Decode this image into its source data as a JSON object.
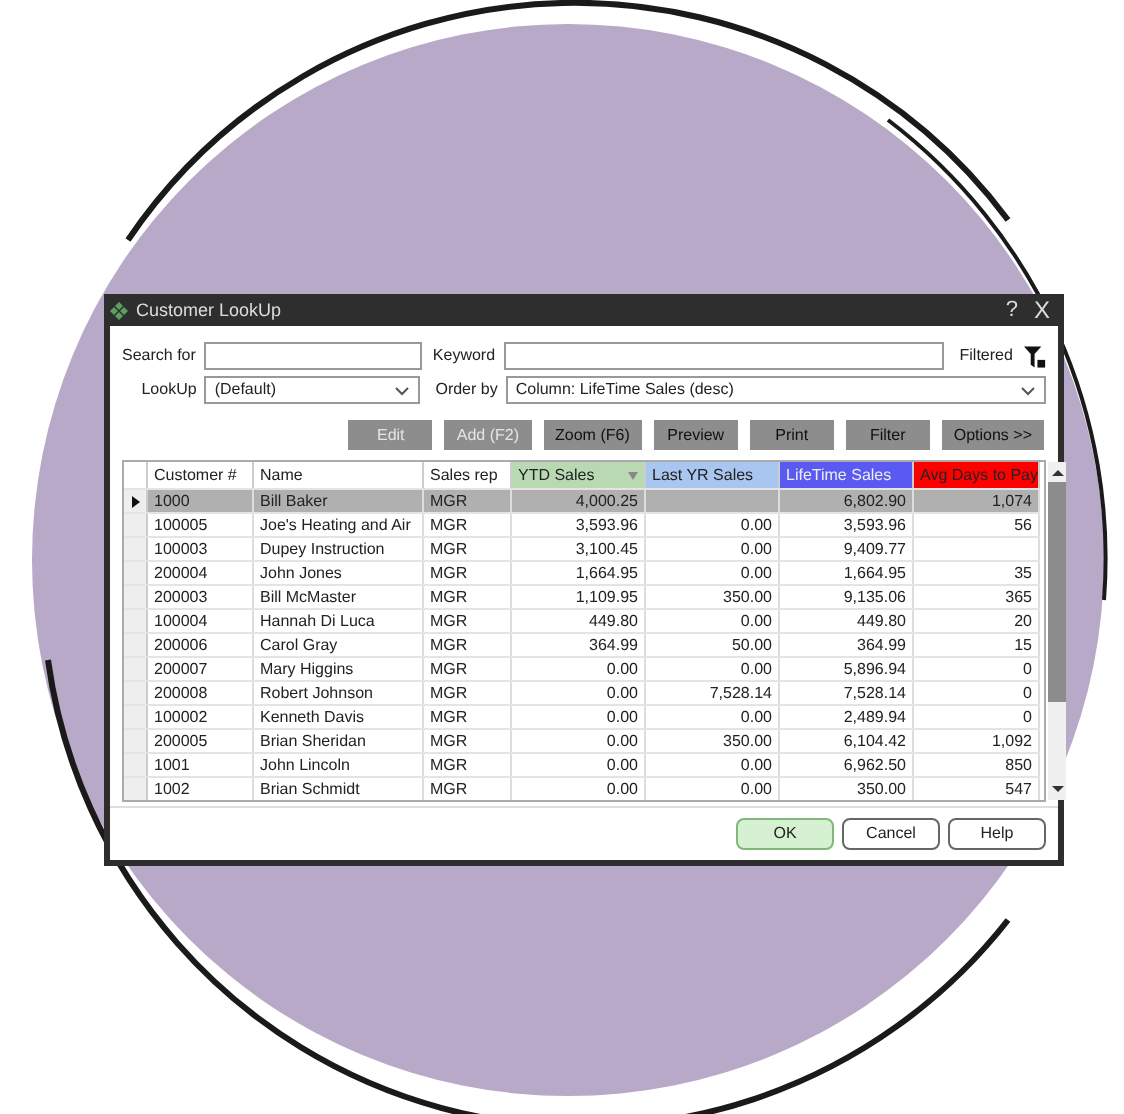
{
  "window": {
    "title": "Customer LookUp",
    "help": "?",
    "close": "X"
  },
  "search": {
    "label": "Search for"
  },
  "keyword": {
    "label": "Keyword"
  },
  "filtered": {
    "label": "Filtered"
  },
  "lookup": {
    "label": "LookUp",
    "value": "(Default)"
  },
  "order_by": {
    "label": "Order by",
    "value": "Column: LifeTime Sales (desc)"
  },
  "toolbar": [
    {
      "label": "Edit",
      "disabled": true
    },
    {
      "label": "Add (F2)",
      "disabled": true
    },
    {
      "label": "Zoom (F6)",
      "disabled": false
    },
    {
      "label": "Preview",
      "disabled": false
    },
    {
      "label": "Print",
      "disabled": false
    },
    {
      "label": "Filter",
      "disabled": false
    },
    {
      "label": "Options >>",
      "disabled": false
    }
  ],
  "table": {
    "columns": [
      {
        "label": "Customer #",
        "color": "#ffffff",
        "sorted": false
      },
      {
        "label": "Name",
        "color": "#ffffff",
        "sorted": false
      },
      {
        "label": "Sales rep",
        "color": "#ffffff",
        "sorted": false
      },
      {
        "label": "YTD Sales",
        "color": "#b9d9b3",
        "sorted": true
      },
      {
        "label": "Last YR Sales",
        "color": "#a8c6ef",
        "sorted": false
      },
      {
        "label": "LifeTime Sales",
        "color": "#5a5af2",
        "sorted": false
      },
      {
        "label": "Avg Days to Pay",
        "color": "#ff0000",
        "sorted": false
      }
    ],
    "rows": [
      {
        "selected": true,
        "cells": [
          "1000",
          "Bill Baker",
          "MGR",
          "4,000.25",
          "",
          "6,802.90",
          "1,074"
        ]
      },
      {
        "selected": false,
        "cells": [
          "100005",
          "Joe's Heating and Air",
          "MGR",
          "3,593.96",
          "0.00",
          "3,593.96",
          "56"
        ]
      },
      {
        "selected": false,
        "cells": [
          "100003",
          "Dupey Instruction",
          "MGR",
          "3,100.45",
          "0.00",
          "9,409.77",
          ""
        ]
      },
      {
        "selected": false,
        "cells": [
          "200004",
          "John Jones",
          "MGR",
          "1,664.95",
          "0.00",
          "1,664.95",
          "35"
        ]
      },
      {
        "selected": false,
        "cells": [
          "200003",
          "Bill McMaster",
          "MGR",
          "1,109.95",
          "350.00",
          "9,135.06",
          "365"
        ]
      },
      {
        "selected": false,
        "cells": [
          "100004",
          "Hannah Di Luca",
          "MGR",
          "449.80",
          "0.00",
          "449.80",
          "20"
        ]
      },
      {
        "selected": false,
        "cells": [
          "200006",
          "Carol Gray",
          "MGR",
          "364.99",
          "50.00",
          "364.99",
          "15"
        ]
      },
      {
        "selected": false,
        "cells": [
          "200007",
          "Mary Higgins",
          "MGR",
          "0.00",
          "0.00",
          "5,896.94",
          "0"
        ]
      },
      {
        "selected": false,
        "cells": [
          "200008",
          "Robert Johnson",
          "MGR",
          "0.00",
          "7,528.14",
          "7,528.14",
          "0"
        ]
      },
      {
        "selected": false,
        "cells": [
          "100002",
          "Kenneth Davis",
          "MGR",
          "0.00",
          "0.00",
          "2,489.94",
          "0"
        ]
      },
      {
        "selected": false,
        "cells": [
          "200005",
          "Brian Sheridan",
          "MGR",
          "0.00",
          "350.00",
          "6,104.42",
          "1,092"
        ]
      },
      {
        "selected": false,
        "cells": [
          "1001",
          "John Lincoln",
          "MGR",
          "0.00",
          "0.00",
          "6,962.50",
          "850"
        ]
      },
      {
        "selected": false,
        "cells": [
          "1002",
          "Brian Schmidt",
          "MGR",
          "0.00",
          "0.00",
          "350.00",
          "547"
        ]
      }
    ]
  },
  "buttons": [
    {
      "label": "OK",
      "default": true
    },
    {
      "label": "Cancel",
      "default": false
    },
    {
      "label": "Help",
      "default": false
    }
  ]
}
